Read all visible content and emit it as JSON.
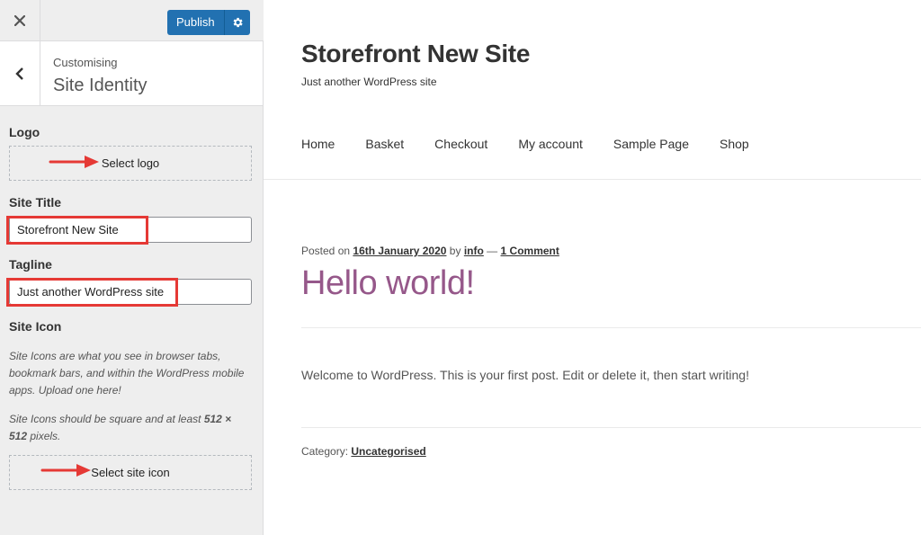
{
  "customizer": {
    "close_icon": "close-icon",
    "publish_label": "Publish",
    "settings_icon": "gear-icon",
    "back_icon": "chevron-left-icon",
    "breadcrumb": "Customising",
    "section_title": "Site Identity",
    "logo": {
      "label": "Logo",
      "button": "Select logo"
    },
    "site_title": {
      "label": "Site Title",
      "value": "Storefront New Site"
    },
    "tagline": {
      "label": "Tagline",
      "value": "Just another WordPress site"
    },
    "site_icon": {
      "label": "Site Icon",
      "description_1": "Site Icons are what you see in browser tabs, bookmark bars, and within the WordPress mobile apps. Upload one here!",
      "description_2_pre": "Site Icons should be square and at least ",
      "description_2_size": "512 × 512",
      "description_2_post": " pixels.",
      "button": "Select site icon"
    },
    "accent_color": "#2271b1",
    "annotation_color": "#e53935"
  },
  "preview": {
    "site_title": "Storefront New Site",
    "tagline": "Just another WordPress site",
    "nav": [
      "Home",
      "Basket",
      "Checkout",
      "My account",
      "Sample Page",
      "Shop"
    ],
    "post": {
      "posted_on": "Posted on",
      "date": "16th January 2020",
      "by": "by",
      "author": "info",
      "dash": "—",
      "comments": "1 Comment",
      "title": "Hello world!",
      "body": "Welcome to WordPress. This is your first post. Edit or delete it, then start writing!",
      "category_label": "Category:",
      "category": "Uncategorised"
    },
    "title_color": "#96588a"
  }
}
